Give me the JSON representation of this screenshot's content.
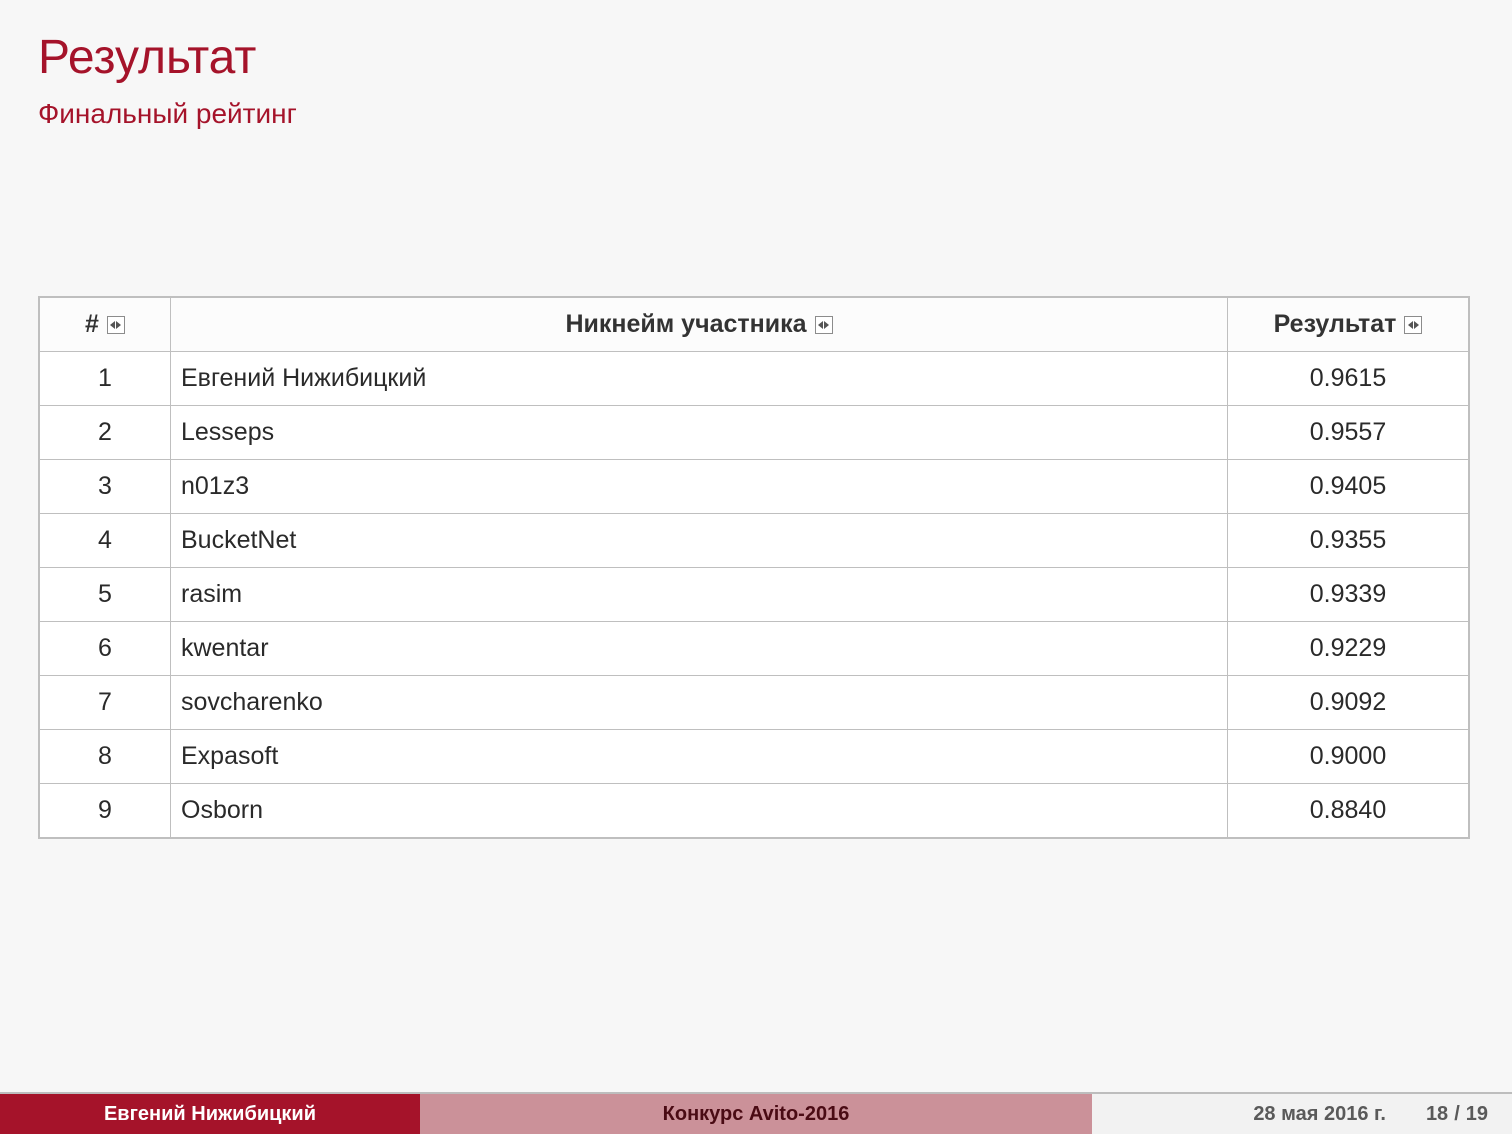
{
  "title": "Результат",
  "subtitle": "Финальный рейтинг",
  "columns": {
    "rank": "#",
    "name": "Никнейм участника",
    "score": "Результат"
  },
  "rows": [
    {
      "rank": "1",
      "name": "Евгений Нижибицкий",
      "score": "0.9615"
    },
    {
      "rank": "2",
      "name": "Lesseps",
      "score": "0.9557"
    },
    {
      "rank": "3",
      "name": "n01z3",
      "score": "0.9405"
    },
    {
      "rank": "4",
      "name": "BucketNet",
      "score": "0.9355"
    },
    {
      "rank": "5",
      "name": "rasim",
      "score": "0.9339"
    },
    {
      "rank": "6",
      "name": "kwentar",
      "score": "0.9229"
    },
    {
      "rank": "7",
      "name": "sovcharenko",
      "score": "0.9092"
    },
    {
      "rank": "8",
      "name": "Expasoft",
      "score": "0.9000"
    },
    {
      "rank": "9",
      "name": "Osborn",
      "score": "0.8840"
    }
  ],
  "footer": {
    "author": "Евгений Нижибицкий",
    "competition": "Конкурс Avito-2016",
    "date": "28 мая 2016 г.",
    "page_current": "18",
    "page_sep": "/",
    "page_total": "19"
  }
}
